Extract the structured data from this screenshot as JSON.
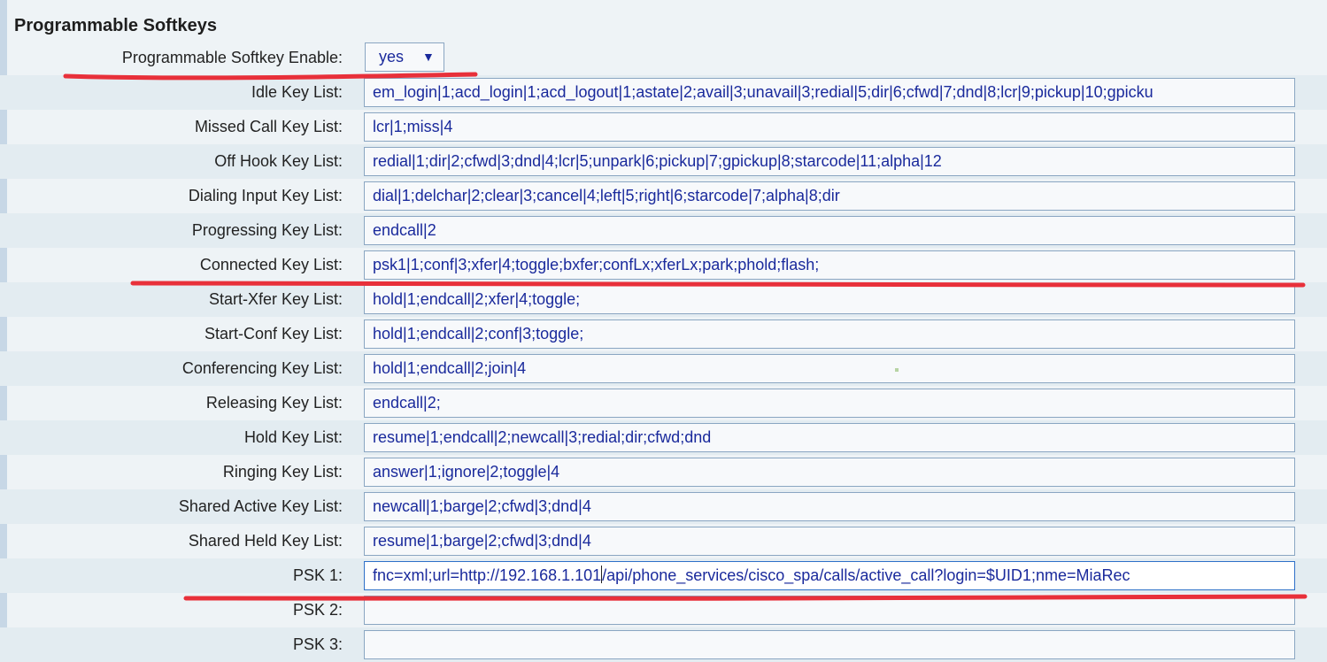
{
  "section": {
    "title": "Programmable Softkeys"
  },
  "enable": {
    "label": "Programmable Softkey Enable:",
    "value": "yes",
    "caret": "▼"
  },
  "rows": [
    {
      "label": "Idle Key List:",
      "value": "em_login|1;acd_login|1;acd_logout|1;astate|2;avail|3;unavail|3;redial|5;dir|6;cfwd|7;dnd|8;lcr|9;pickup|10;gpicku"
    },
    {
      "label": "Missed Call Key List:",
      "value": "lcr|1;miss|4"
    },
    {
      "label": "Off Hook Key List:",
      "value": "redial|1;dir|2;cfwd|3;dnd|4;lcr|5;unpark|6;pickup|7;gpickup|8;starcode|11;alpha|12"
    },
    {
      "label": "Dialing Input Key List:",
      "value": "dial|1;delchar|2;clear|3;cancel|4;left|5;right|6;starcode|7;alpha|8;dir"
    },
    {
      "label": "Progressing Key List:",
      "value": "endcall|2"
    },
    {
      "label": "Connected Key List:",
      "value": "psk1|1;conf|3;xfer|4;toggle;bxfer;confLx;xferLx;park;phold;flash;"
    },
    {
      "label": "Start-Xfer Key List:",
      "value": "hold|1;endcall|2;xfer|4;toggle;"
    },
    {
      "label": "Start-Conf Key List:",
      "value": "hold|1;endcall|2;conf|3;toggle;"
    },
    {
      "label": "Conferencing Key List:",
      "value": "hold|1;endcall|2;join|4"
    },
    {
      "label": "Releasing Key List:",
      "value": "endcall|2;"
    },
    {
      "label": "Hold Key List:",
      "value": "resume|1;endcall|2;newcall|3;redial;dir;cfwd;dnd"
    },
    {
      "label": "Ringing Key List:",
      "value": "answer|1;ignore|2;toggle|4"
    },
    {
      "label": "Shared Active Key List:",
      "value": "newcall|1;barge|2;cfwd|3;dnd|4"
    },
    {
      "label": "Shared Held Key List:",
      "value": "resume|1;barge|2;cfwd|3;dnd|4"
    }
  ],
  "psk1": {
    "label": "PSK 1:",
    "value_before_cursor": "fnc=xml;url=http://192.168.1.101",
    "value_after_cursor": "/api/phone_services/cisco_spa/calls/active_call?login=$UID1;nme=MiaRec"
  },
  "psk2": {
    "label": "PSK 2:",
    "value": ""
  },
  "psk3": {
    "label": "PSK 3:",
    "value": ""
  },
  "annotation_color": "#e8303a"
}
